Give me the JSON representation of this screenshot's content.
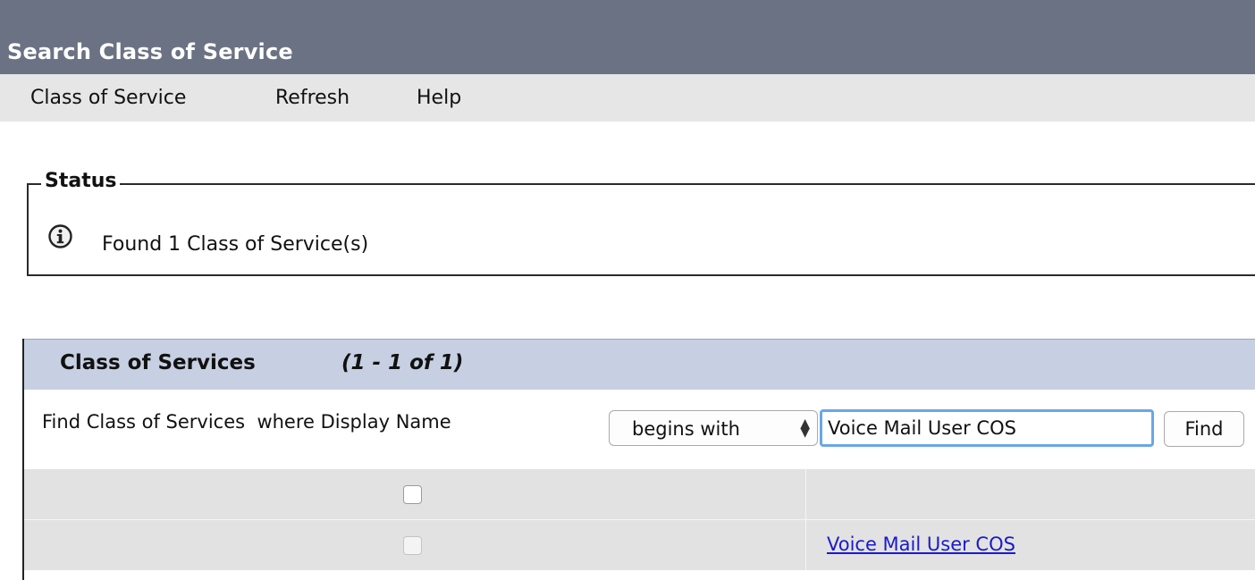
{
  "header": {
    "title": "Search Class of Service"
  },
  "menu": {
    "items": [
      {
        "label": "Class of Service"
      },
      {
        "label": "Refresh"
      },
      {
        "label": "Help"
      }
    ]
  },
  "status": {
    "legend": "Status",
    "icon": "info-icon",
    "message": "Found 1 Class of Service(s)"
  },
  "results": {
    "title": "Class of Services",
    "count": "(1 - 1 of 1)",
    "find": {
      "label": "Find Class of Services  where Display Name",
      "operator": "begins with",
      "query": "Voice Mail User COS",
      "button": "Find"
    },
    "rows": [
      {
        "checked": false,
        "name": ""
      },
      {
        "checked": false,
        "name": "Voice Mail User COS"
      }
    ]
  },
  "colors": {
    "titlebar": "#6b7283",
    "menubar": "#e6e6e6",
    "results_header": "#c7cfe2",
    "row": "#e2e2e2",
    "link": "#1a1ad0",
    "focus": "#6aa6e8"
  }
}
